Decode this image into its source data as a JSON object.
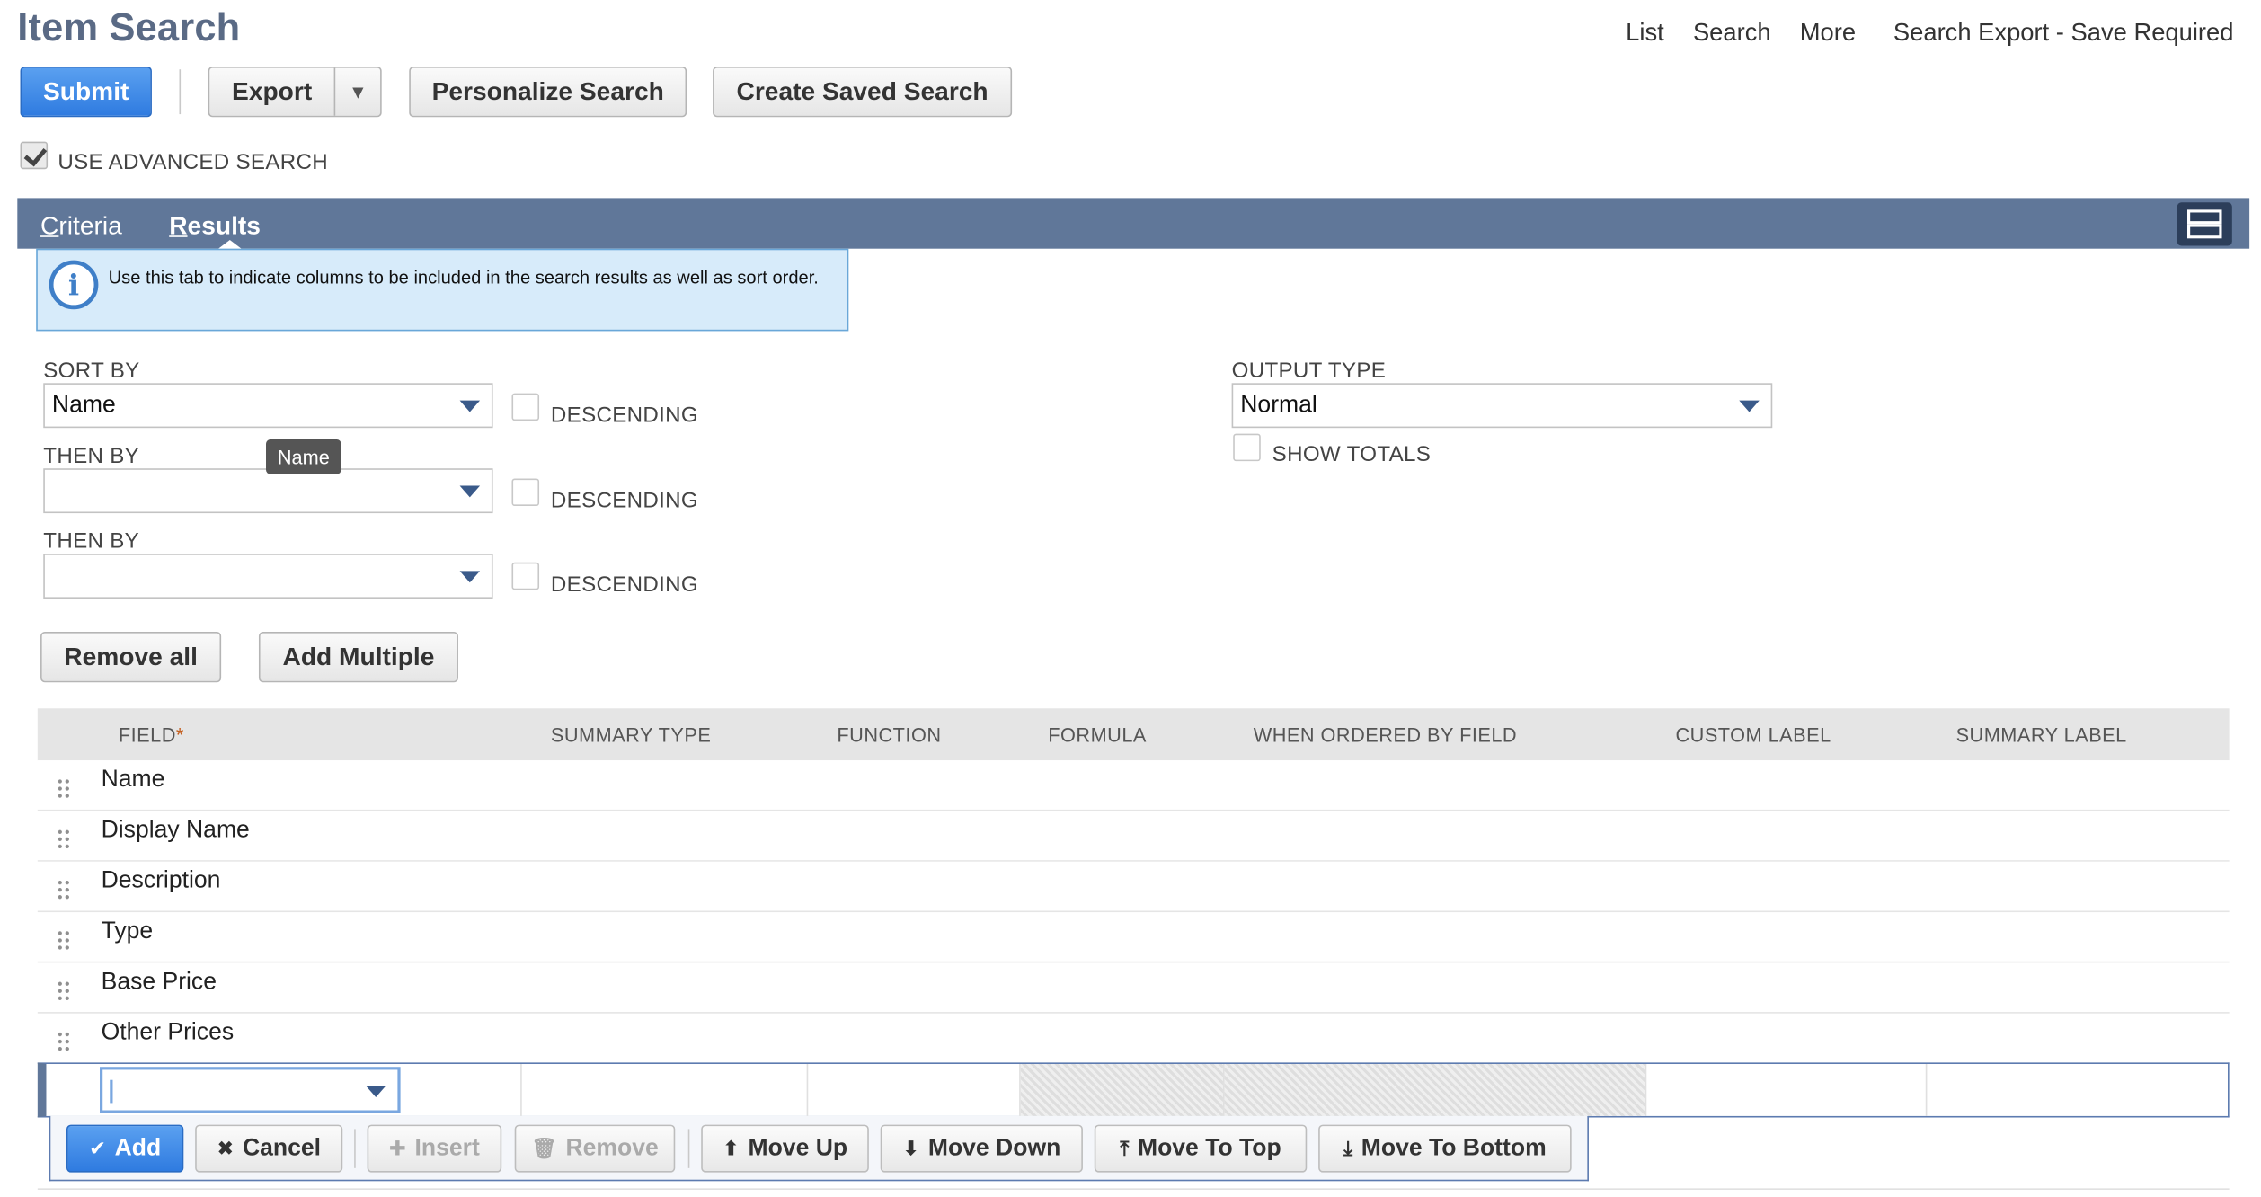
{
  "header": {
    "title": "Item Search",
    "links": [
      "List",
      "Search",
      "More",
      "Search Export - Save Required"
    ]
  },
  "actions": {
    "submit": "Submit",
    "export": "Export",
    "export_menu": "▼",
    "personalize": "Personalize Search",
    "create_saved": "Create Saved Search"
  },
  "advanced_search": {
    "label": "USE ADVANCED SEARCH",
    "checked": true
  },
  "tabs": [
    {
      "label_first": "C",
      "label_rest": "riteria",
      "active": false
    },
    {
      "label_first": "R",
      "label_rest": "esults",
      "active": true
    }
  ],
  "info": {
    "icon": "info-icon",
    "text": "Use this tab to indicate columns to be included in the search results as well as sort order."
  },
  "sort": {
    "sort_by_label": "SORT BY",
    "sort_by_value": "Name",
    "then_by_label_1": "THEN BY",
    "then_by_value_1": "",
    "then_by_label_2": "THEN BY",
    "then_by_value_2": "",
    "descending_label": "DESCENDING",
    "tooltip": "Name"
  },
  "output": {
    "label": "OUTPUT TYPE",
    "value": "Normal",
    "show_totals_label": "SHOW TOTALS"
  },
  "list_actions": {
    "remove_all": "Remove all",
    "add_multiple": "Add Multiple"
  },
  "grid": {
    "columns": [
      "FIELD",
      "SUMMARY TYPE",
      "FUNCTION",
      "FORMULA",
      "WHEN ORDERED BY FIELD",
      "CUSTOM LABEL",
      "SUMMARY LABEL"
    ],
    "required_marker": "*",
    "rows": [
      "Name",
      "Display Name",
      "Description",
      "Type",
      "Base Price",
      "Other Prices"
    ]
  },
  "row_toolbar": {
    "add": "Add",
    "cancel": "Cancel",
    "insert": "Insert",
    "remove": "Remove",
    "move_up": "Move Up",
    "move_down": "Move Down",
    "move_to_top": "Move To Top",
    "move_to_bottom": "Move To Bottom"
  },
  "colors": {
    "accent": "#2f7be0",
    "tabbar": "#607799",
    "title": "#5a6a85",
    "info_bg": "#d7ebfa"
  }
}
